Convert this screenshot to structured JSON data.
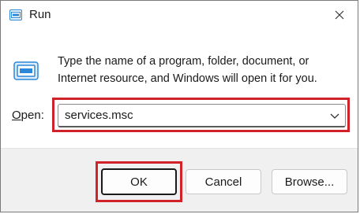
{
  "window": {
    "title": "Run",
    "close_icon": "close-icon",
    "title_icon": "run-icon"
  },
  "description": {
    "line1": "Type the name of a program, folder, document, or",
    "line2": "Internet resource, and Windows will open it for you."
  },
  "open_field": {
    "label_accel": "O",
    "label_rest": "pen:",
    "value": "services.msc",
    "dropdown_icon": "chevron-down-icon"
  },
  "buttons": {
    "ok": "OK",
    "cancel": "Cancel",
    "browse": "Browse..."
  },
  "colors": {
    "highlight": "#d1222a",
    "icon_blue": "#2b88d8",
    "footer_bg": "#f0f0f0"
  }
}
